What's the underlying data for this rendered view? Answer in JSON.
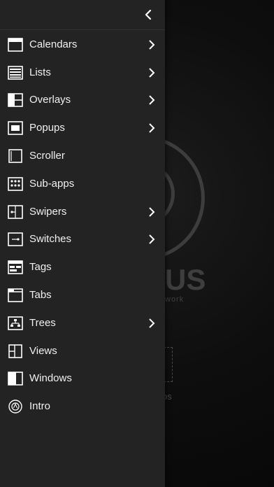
{
  "background": {
    "logo_text": "US",
    "logo_subtext": "work",
    "app_label": "os"
  },
  "drawer": {
    "back_icon": "chevron-left-icon",
    "items": [
      {
        "label": "Calendars",
        "icon": "calendar-icon",
        "has_submenu": true
      },
      {
        "label": "Lists",
        "icon": "list-icon",
        "has_submenu": true
      },
      {
        "label": "Overlays",
        "icon": "overlay-icon",
        "has_submenu": true
      },
      {
        "label": "Popups",
        "icon": "popup-icon",
        "has_submenu": true
      },
      {
        "label": "Scroller",
        "icon": "scroller-icon",
        "has_submenu": false
      },
      {
        "label": "Sub-apps",
        "icon": "sub-apps-icon",
        "has_submenu": false
      },
      {
        "label": "Swipers",
        "icon": "swiper-icon",
        "has_submenu": true
      },
      {
        "label": "Switches",
        "icon": "switch-icon",
        "has_submenu": true
      },
      {
        "label": "Tags",
        "icon": "tags-icon",
        "has_submenu": false
      },
      {
        "label": "Tabs",
        "icon": "tabs-icon",
        "has_submenu": false
      },
      {
        "label": "Trees",
        "icon": "tree-icon",
        "has_submenu": true
      },
      {
        "label": "Views",
        "icon": "views-icon",
        "has_submenu": false
      },
      {
        "label": "Windows",
        "icon": "window-icon",
        "has_submenu": false
      },
      {
        "label": "Intro",
        "icon": "intro-icon",
        "has_submenu": false
      }
    ]
  },
  "colors": {
    "drawer_bg": "#232323",
    "text": "#f0f0f0",
    "background": "#0b0b0b"
  }
}
